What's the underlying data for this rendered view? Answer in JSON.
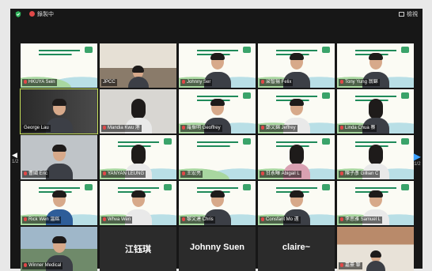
{
  "topbar": {
    "recording_text": "錄製中",
    "view_label": "檢視"
  },
  "pager": {
    "left": "1/2",
    "right": "1/2"
  },
  "tiles": [
    {
      "label": "HKUYA Sein",
      "muted": true
    },
    {
      "label": "JPCC",
      "muted": false
    },
    {
      "label": "Johnny Ser",
      "muted": true
    },
    {
      "label": "梁智揚 Felix",
      "muted": true
    },
    {
      "label": "Tony Yung 翁錦",
      "muted": true
    },
    {
      "label": "George Lau",
      "muted": false
    },
    {
      "label": "Mandia Kwu 港",
      "muted": true
    },
    {
      "label": "羅振明 Geoffrey",
      "muted": true
    },
    {
      "label": "鄭文錦 Jeffrey",
      "muted": true
    },
    {
      "label": "Linda Chua 蔡",
      "muted": true
    },
    {
      "label": "曹國 Eric",
      "muted": true
    },
    {
      "label": "YANYAN LEUNG",
      "muted": true
    },
    {
      "label": "王宏亮",
      "muted": true
    },
    {
      "label": "甘永暉 Abigail L",
      "muted": true
    },
    {
      "label": "陳子彥 Gillian C",
      "muted": true
    },
    {
      "label": "Rick Wen 溫銘",
      "muted": true
    },
    {
      "label": "Whva Wen",
      "muted": true
    },
    {
      "label": "黎文達 Chris",
      "muted": true
    },
    {
      "label": "Consfant Mo 遠",
      "muted": true
    },
    {
      "label": "李思雅 Samuel L",
      "muted": true
    },
    {
      "label": "Winner Medical",
      "muted": true
    },
    {
      "big": "江钰琪"
    },
    {
      "big": "Johnny Suen"
    },
    {
      "big": "claire~"
    },
    {
      "label": "嘉豪 黎",
      "muted": true
    }
  ]
}
